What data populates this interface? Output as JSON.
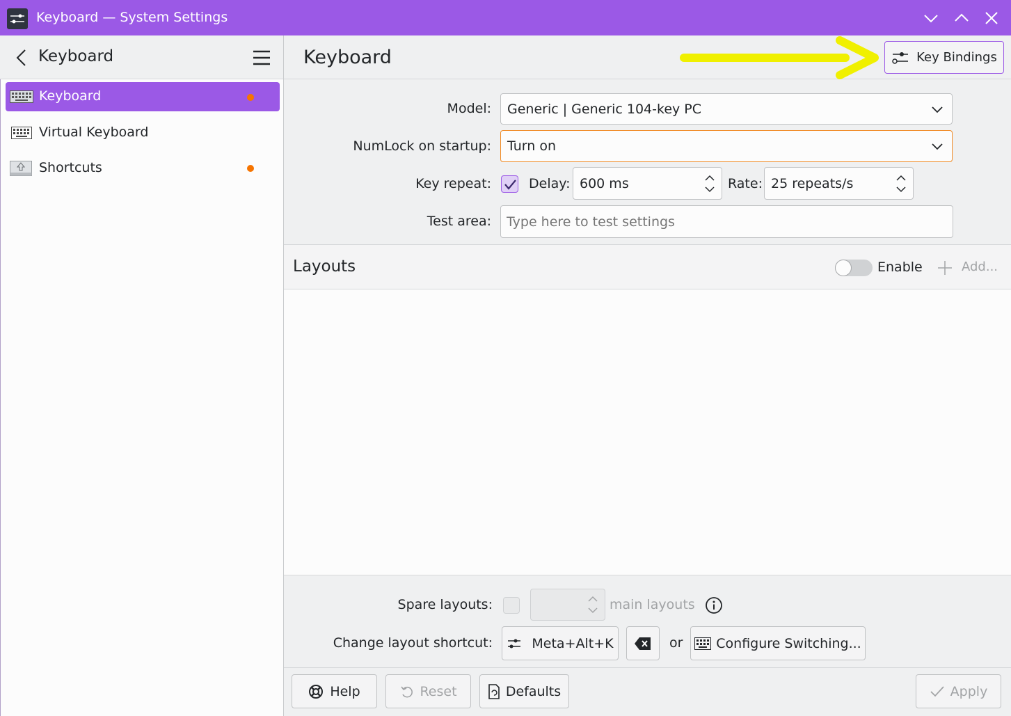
{
  "window": {
    "title": "Keyboard — System Settings"
  },
  "sidebar": {
    "title": "Keyboard",
    "items": [
      {
        "label": "Keyboard",
        "active": true,
        "modified": true
      },
      {
        "label": "Virtual Keyboard",
        "active": false,
        "modified": false
      },
      {
        "label": "Shortcuts",
        "active": false,
        "modified": true
      }
    ]
  },
  "page": {
    "title": "Keyboard",
    "key_bindings_label": "Key Bindings"
  },
  "form": {
    "model_label": "Model:",
    "model_value": "Generic | Generic 104-key PC",
    "numlock_label": "NumLock on startup:",
    "numlock_value": "Turn on",
    "key_repeat_label": "Key repeat:",
    "key_repeat_checked": true,
    "delay_label": "Delay:",
    "delay_value": "600 ms",
    "rate_label": "Rate:",
    "rate_value": "25 repeats/s",
    "test_area_label": "Test area:",
    "test_area_placeholder": "Type here to test settings"
  },
  "layouts": {
    "title": "Layouts",
    "enable_label": "Enable",
    "add_label": "Add..."
  },
  "bottom": {
    "spare_label": "Spare layouts:",
    "main_layouts_label": "main layouts",
    "change_shortcut_label": "Change layout shortcut:",
    "shortcut_value": "Meta+Alt+K",
    "or_label": "or",
    "configure_label": "Configure Switching..."
  },
  "footer": {
    "help_label": "Help",
    "reset_label": "Reset",
    "defaults_label": "Defaults",
    "apply_label": "Apply"
  },
  "colors": {
    "accent": "#9b59e6",
    "modified": "#f67400",
    "annotation_arrow": "#ffff00"
  }
}
